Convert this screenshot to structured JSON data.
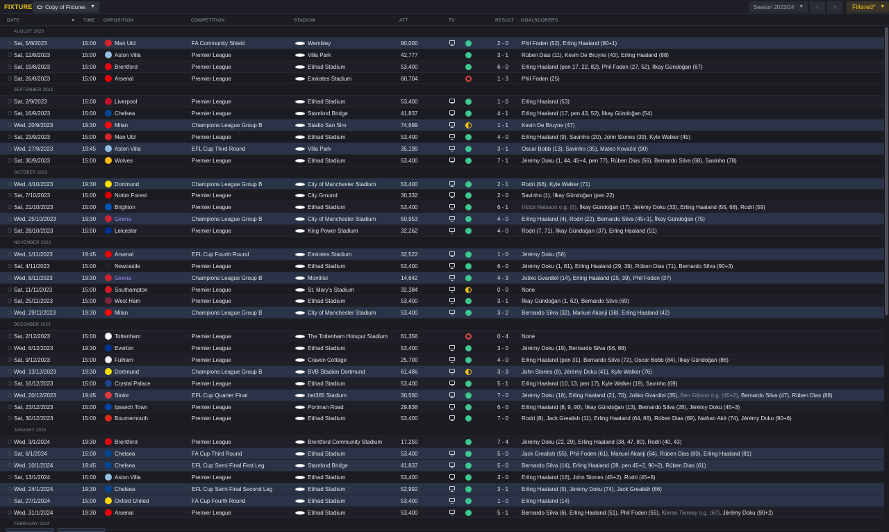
{
  "topbar": {
    "title": "FIXTURES",
    "view_label": "Copy of Fixtures",
    "season_label": "Season 2023/24",
    "filter_label": "Filtered*"
  },
  "columns": {
    "date": "DATE",
    "time": "TIME",
    "opposition": "OPPOSITION",
    "competition": "COMPETITION",
    "stadium": "STADIUM",
    "att": "ATT",
    "tv": "TV",
    "result": "RESULT",
    "goalscorers": "GOALSCORERS"
  },
  "colors": {
    "accent": "#f0c419",
    "win": "#3ec78f",
    "loss": "#e0463d",
    "highlight_row": "#2a3347",
    "opposition_highlight": "#a78bfa"
  },
  "rows": [
    {
      "type": "month",
      "label": "AUGUST 2023"
    },
    {
      "date": "Sat, 5/8/2023",
      "time": "15:00",
      "opp": "Man Utd",
      "crest": "#d8232a",
      "comp": "FA Community Shield",
      "stadium": "Wembley",
      "att": "90,000",
      "tv": true,
      "res": "w",
      "score": "2 - 0",
      "goals": "Phil Foden (52), Erling Haaland (90+1)",
      "hl": true
    },
    {
      "date": "Sat, 12/8/2023",
      "time": "15:00",
      "opp": "Aston Villa",
      "crest": "#95bfe5",
      "comp": "Premier League",
      "stadium": "Villa Park",
      "att": "42,777",
      "tv": false,
      "res": "w",
      "score": "3 - 1",
      "goals": "Rúben Dias (11), Kevin De Bruyne (43), Erling Haaland (88)"
    },
    {
      "date": "Sat, 19/8/2023",
      "time": "15:00",
      "opp": "Brentford",
      "crest": "#e30613",
      "comp": "Premier League",
      "stadium": "Etihad Stadium",
      "att": "53,400",
      "tv": false,
      "res": "w",
      "score": "6 - 0",
      "goals": "Erling Haaland (pen 17, 22, 82), Phil Foden (27, 52), İlkay Gündoğan (67)"
    },
    {
      "date": "Sat, 26/8/2023",
      "time": "15:00",
      "opp": "Arsenal",
      "crest": "#ef0107",
      "comp": "Premier League",
      "stadium": "Emirates Stadium",
      "att": "60,704",
      "tv": false,
      "res": "l",
      "score": "1 - 3",
      "goals": "Phil Foden (25)"
    },
    {
      "type": "month",
      "label": "SEPTEMBER 2023"
    },
    {
      "date": "Sat, 2/9/2023",
      "time": "15:00",
      "opp": "Liverpool",
      "crest": "#c8102e",
      "comp": "Premier League",
      "stadium": "Etihad Stadium",
      "att": "53,400",
      "tv": true,
      "res": "w",
      "score": "1 - 0",
      "goals": "Erling Haaland (53)"
    },
    {
      "date": "Sat, 16/9/2023",
      "time": "15:00",
      "opp": "Chelsea",
      "crest": "#034694",
      "comp": "Premier League",
      "stadium": "Stamford Bridge",
      "att": "41,837",
      "tv": true,
      "res": "w",
      "score": "4 - 1",
      "goals": "Erling Haaland (17, pen 43, 52), İlkay Gündoğan (54)"
    },
    {
      "date": "Wed, 20/9/2023",
      "time": "19:30",
      "opp": "Milan",
      "crest": "#fb090b",
      "comp": "Champions League Group B",
      "stadium": "Stadio San Siro",
      "att": "74,699",
      "tv": true,
      "res": "d",
      "score": "1 - 1",
      "goals": "Kevin De Bruyne (47)",
      "hl": true
    },
    {
      "date": "Sat, 23/9/2023",
      "time": "15:00",
      "opp": "Man Utd",
      "crest": "#d8232a",
      "comp": "Premier League",
      "stadium": "Etihad Stadium",
      "att": "53,400",
      "tv": true,
      "res": "w",
      "score": "4 - 0",
      "goals": "Erling Haaland (9), Savinho (20), John Stones (39), Kyle Walker (45)"
    },
    {
      "date": "Wed, 27/9/2023",
      "time": "19:45",
      "opp": "Aston Villa",
      "crest": "#95bfe5",
      "comp": "EFL Cup Third Round",
      "stadium": "Villa Park",
      "att": "35,199",
      "tv": true,
      "res": "w",
      "score": "3 - 1",
      "goals": "Oscar Bobb (13), Savinho (35), Mateo Kovačić (90)",
      "hl": true
    },
    {
      "date": "Sat, 30/9/2023",
      "time": "15:00",
      "opp": "Wolves",
      "crest": "#fdb913",
      "comp": "Premier League",
      "stadium": "Etihad Stadium",
      "att": "53,400",
      "tv": true,
      "res": "w",
      "score": "7 - 1",
      "goals": "Jérémy Doku (1, 44, 45+4, pen 77), Rúben Dias (56), Bernardo Silva (68), Savinho (78)"
    },
    {
      "type": "month",
      "label": "OCTOBER 2023"
    },
    {
      "date": "Wed, 4/10/2023",
      "time": "19:30",
      "opp": "Dortmund",
      "crest": "#fde100",
      "comp": "Champions League Group B",
      "stadium": "City of Manchester Stadium",
      "att": "53,400",
      "tv": true,
      "res": "w",
      "score": "2 - 1",
      "goals": "Rodri (56), Kyle Walker (71)",
      "hl": true
    },
    {
      "date": "Sat, 7/10/2023",
      "time": "15:00",
      "opp": "Nottm Forest",
      "crest": "#dd0000",
      "comp": "Premier League",
      "stadium": "City Ground",
      "att": "30,332",
      "tv": true,
      "res": "w",
      "score": "2 - 0",
      "goals": "Savinho (1), İlkay Gündoğan (pen 22)"
    },
    {
      "date": "Sat, 21/10/2023",
      "time": "15:00",
      "opp": "Brighton",
      "crest": "#0057b8",
      "comp": "Premier League",
      "stadium": "Etihad Stadium",
      "att": "53,400",
      "tv": true,
      "res": "w",
      "score": "6 - 1",
      "goals_muted": "Victor Nelsson o.g. (5), ",
      "goals": "İlkay Gündoğan (17), Jérémy Doku (33), Erling Haaland (55, 68), Rodri (59)"
    },
    {
      "date": "Wed, 25/10/2023",
      "time": "19:30",
      "opp": "Girona",
      "opp_purple": true,
      "crest": "#cd2534",
      "comp": "Champions League Group B",
      "stadium": "City of Manchester Stadium",
      "att": "50,953",
      "tv": true,
      "res": "w",
      "score": "4 - 0",
      "goals": "Erling Haaland (4), Rodri (22), Bernardo Silva (45+1), İlkay Gündoğan (75)",
      "hl": true
    },
    {
      "date": "Sat, 28/10/2023",
      "time": "15:00",
      "opp": "Leicester",
      "crest": "#003090",
      "comp": "Premier League",
      "stadium": "King Power Stadium",
      "att": "32,262",
      "tv": true,
      "res": "w",
      "score": "4 - 0",
      "goals": "Rodri (7, 71), İlkay Gündoğan (37), Erling Haaland (51)"
    },
    {
      "type": "month",
      "label": "NOVEMBER 2023"
    },
    {
      "date": "Wed, 1/11/2023",
      "time": "19:45",
      "opp": "Arsenal",
      "crest": "#ef0107",
      "comp": "EFL Cup Fourth Round",
      "stadium": "Emirates Stadium",
      "att": "32,522",
      "tv": true,
      "res": "w",
      "score": "1 - 0",
      "goals": "Jérémy Doku (56)",
      "hl": true
    },
    {
      "date": "Sat, 4/11/2023",
      "time": "15:00",
      "opp": "Newcastle",
      "crest": "#241f20",
      "comp": "Premier League",
      "stadium": "Etihad Stadium",
      "att": "53,400",
      "tv": true,
      "res": "w",
      "score": "6 - 0",
      "goals": "Jérémy Doku (1, 81), Erling Haaland (29, 39), Rúben Dias (71), Bernardo Silva (90+3)"
    },
    {
      "date": "Wed, 8/11/2023",
      "time": "19:30",
      "opp": "Girona",
      "opp_purple": true,
      "crest": "#cd2534",
      "comp": "Champions League Group B",
      "stadium": "Montilivi",
      "att": "14,642",
      "tv": true,
      "res": "w",
      "score": "4 - 3",
      "goals": "Joško Gvardiol (14), Erling Haaland (25, 39), Phil Foden (37)",
      "hl": true
    },
    {
      "date": "Sat, 11/11/2023",
      "time": "15:00",
      "opp": "Southampton",
      "crest": "#d71920",
      "comp": "Premier League",
      "stadium": "St. Mary's Stadium",
      "att": "32,384",
      "tv": true,
      "res": "d",
      "score": "0 - 0",
      "goals": "None"
    },
    {
      "date": "Sat, 25/11/2023",
      "time": "15:00",
      "opp": "West Ham",
      "crest": "#7a263a",
      "comp": "Premier League",
      "stadium": "Etihad Stadium",
      "att": "53,400",
      "tv": true,
      "res": "w",
      "score": "3 - 1",
      "goals": "İlkay Gündoğan (1, 62), Bernardo Silva (69)"
    },
    {
      "date": "Wed, 29/11/2023",
      "time": "19:30",
      "opp": "Milan",
      "crest": "#fb090b",
      "comp": "Champions League Group B",
      "stadium": "City of Manchester Stadium",
      "att": "53,400",
      "tv": true,
      "res": "w",
      "score": "3 - 2",
      "goals": "Bernardo Silva (32), Manuel Akanji (38), Erling Haaland (42)",
      "hl": true
    },
    {
      "type": "month",
      "label": "DECEMBER 2023"
    },
    {
      "date": "Sat, 2/12/2023",
      "time": "15:00",
      "opp": "Tottenham",
      "crest": "#ffffff",
      "comp": "Premier League",
      "stadium": "The Tottenham Hotspur Stadium",
      "att": "61,356",
      "tv": false,
      "res": "l",
      "score": "0 - 4",
      "goals": "None"
    },
    {
      "date": "Wed, 6/12/2023",
      "time": "19:30",
      "opp": "Everton",
      "crest": "#003399",
      "comp": "Premier League",
      "stadium": "Etihad Stadium",
      "att": "53,400",
      "tv": true,
      "res": "w",
      "score": "3 - 0",
      "goals": "Jérémy Doku (19), Bernardo Silva (56, 88)"
    },
    {
      "date": "Sat, 9/12/2023",
      "time": "15:00",
      "opp": "Fulham",
      "crest": "#eeeeee",
      "comp": "Premier League",
      "stadium": "Craven Cottage",
      "att": "25,700",
      "tv": true,
      "res": "w",
      "score": "4 - 0",
      "goals": "Erling Haaland (pen 31), Bernardo Silva (72), Oscar Bobb (84), İlkay Gündoğan (86)"
    },
    {
      "date": "Wed, 13/12/2023",
      "time": "19:30",
      "opp": "Dortmund",
      "crest": "#fde100",
      "comp": "Champions League Group B",
      "stadium": "BVB Stadion Dortmund",
      "att": "61,486",
      "tv": true,
      "res": "d",
      "score": "3 - 3",
      "goals": "John Stones (9), Jérémy Doku (41), Kyle Walker (76)",
      "hl": true
    },
    {
      "date": "Sat, 16/12/2023",
      "time": "15:00",
      "opp": "Crystal Palace",
      "crest": "#1b458f",
      "comp": "Premier League",
      "stadium": "Etihad Stadium",
      "att": "53,400",
      "tv": true,
      "res": "w",
      "score": "5 - 1",
      "goals": "Erling Haaland (10, 13, pen 17), Kyle Walker (19), Savinho (69)"
    },
    {
      "date": "Wed, 20/12/2023",
      "time": "19:45",
      "opp": "Stoke",
      "crest": "#e03a3e",
      "comp": "EFL Cup Quarter Final",
      "stadium": "bet365 Stadium",
      "att": "30,560",
      "tv": true,
      "res": "w",
      "score": "7 - 0",
      "goals": "Jérémy Doku (18), Erling Haaland (21, 70), Joško Gvardiol (35), ",
      "goals_mid_muted": "Ben Gibson o.g. (45+2)",
      "goals_tail": ", Bernardo Silva (47), Rúben Dias (88)",
      "hl": true
    },
    {
      "date": "Sat, 23/12/2023",
      "time": "15:00",
      "opp": "Ipswich Town",
      "crest": "#0044aa",
      "comp": "Premier League",
      "stadium": "Portman Road",
      "att": "29,838",
      "tv": true,
      "res": "w",
      "score": "6 - 0",
      "goals": "Erling Haaland (8, 9, 90), İlkay Gündoğan (13), Bernardo Silva (28), Jérémy Doku (45+3)"
    },
    {
      "date": "Sat, 30/12/2023",
      "time": "15:00",
      "opp": "Bournemouth",
      "crest": "#da291c",
      "comp": "Premier League",
      "stadium": "Etihad Stadium",
      "att": "53,400",
      "tv": true,
      "res": "w",
      "score": "7 - 0",
      "goals": "Rodri (8), Jack Grealish (11), Erling Haaland (64, 66), Rúben Dias (69), Nathan Aké (74), Jérémy Doku (90+6)"
    },
    {
      "type": "month",
      "label": "JANUARY 2024"
    },
    {
      "date": "Wed, 3/1/2024",
      "time": "19:30",
      "opp": "Brentford",
      "crest": "#e30613",
      "comp": "Premier League",
      "stadium": "Brentford Community Stadium",
      "att": "17,250",
      "tv": false,
      "res": "w",
      "score": "7 - 4",
      "goals": "Jérémy Doku (22, 29), Erling Haaland (38, 47, 80), Rodri (40, 43)"
    },
    {
      "date": "Sat, 6/1/2024",
      "time": "15:00",
      "opp": "Chelsea",
      "crest": "#034694",
      "comp": "FA Cup Third Round",
      "stadium": "Etihad Stadium",
      "att": "53,400",
      "tv": true,
      "res": "w",
      "score": "5 - 0",
      "goals": "Jack Grealish (55), Phil Foden (61), Manuel Akanji (64), Rúben Dias (80), Erling Haaland (81)",
      "hl": true
    },
    {
      "date": "Wed, 10/1/2024",
      "time": "19:45",
      "opp": "Chelsea",
      "crest": "#034694",
      "comp": "EFL Cup Semi Final First Leg",
      "stadium": "Stamford Bridge",
      "att": "41,837",
      "tv": true,
      "res": "w",
      "score": "5 - 0",
      "goals": "Bernardo Silva (14), Erling Haaland (28, pen 45+2, 90+2), Rúben Dias (61)",
      "hl": true
    },
    {
      "date": "Sat, 13/1/2024",
      "time": "15:00",
      "opp": "Aston Villa",
      "crest": "#95bfe5",
      "comp": "Premier League",
      "stadium": "Etihad Stadium",
      "att": "53,400",
      "tv": true,
      "res": "w",
      "score": "3 - 0",
      "goals": "Erling Haaland (16), John Stones (45+2), Rodri (45+6)"
    },
    {
      "date": "Wed, 24/1/2024",
      "time": "19:30",
      "opp": "Chelsea",
      "crest": "#034694",
      "comp": "EFL Cup Semi Final Second Leg",
      "stadium": "Etihad Stadium",
      "att": "52,992",
      "tv": true,
      "res": "w",
      "score": "3 - 1",
      "goals": "Erling Haaland (5), Jérémy Doku (74), Jack Grealish (86)",
      "hl": true
    },
    {
      "date": "Sat, 27/1/2024",
      "time": "15:00",
      "opp": "Oxford United",
      "crest": "#ffd700",
      "comp": "FA Cup Fourth Round",
      "stadium": "Etihad Stadium",
      "att": "53,400",
      "tv": true,
      "res": "w",
      "score": "1 - 0",
      "goals": "Erling Haaland (14)",
      "hl": true
    },
    {
      "date": "Wed, 31/1/2024",
      "time": "19:30",
      "opp": "Arsenal",
      "crest": "#ef0107",
      "comp": "Premier League",
      "stadium": "Etihad Stadium",
      "att": "53,400",
      "tv": true,
      "res": "w",
      "score": "5 - 1",
      "goals": "Bernardo Silva (6), Erling Haaland (51), Phil Foden (55), ",
      "goals_mid_muted": "Kieran Tierney o.g. (67)",
      "goals_tail": ", Jérémy Doku (90+2)"
    },
    {
      "type": "month",
      "label": "FEBRUARY 2024"
    }
  ]
}
